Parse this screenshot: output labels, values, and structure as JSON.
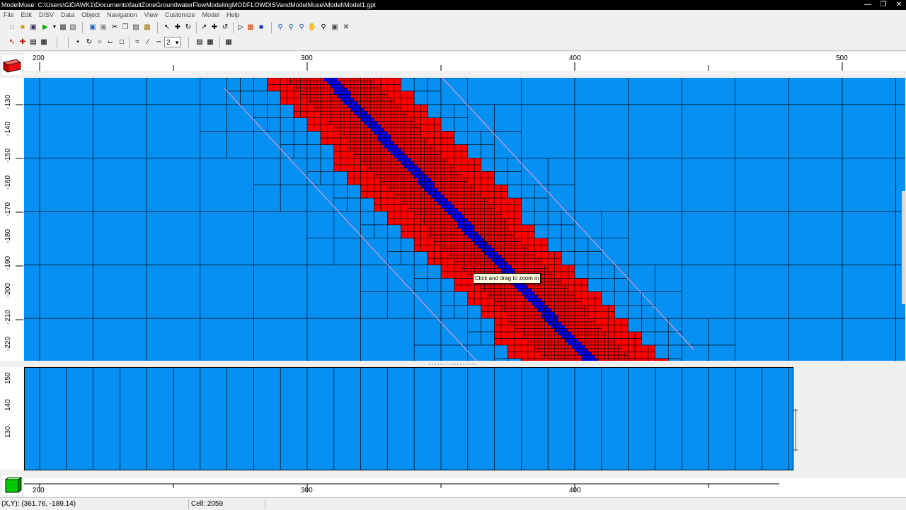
{
  "window": {
    "title": "ModelMuse: C:\\Users\\GIDAWK1\\Documents\\faultZoneGroundwaterFlowModelingMODFLOWDISVandModelMuse\\Model\\Model1.gpt",
    "controls": [
      "minimize-icon",
      "restore-icon",
      "close-icon"
    ]
  },
  "menu": [
    "File",
    "Edit",
    "DISV",
    "Data",
    "Object",
    "Navigation",
    "View",
    "Customize",
    "Model",
    "Help"
  ],
  "toolbar": {
    "row1_icons": [
      "new-icon",
      "open-icon",
      "save-icon",
      "run-icon",
      "run-dropdown-icon",
      "export-icon",
      "print-icon",
      "undo-icon",
      "redo-icon",
      "cut-icon",
      "copy-icon",
      "paste-icon",
      "grid-icon",
      "pointer-icon",
      "edit-vertex-icon",
      "rotate-icon",
      "select-icon",
      "add-point-icon",
      "move-icon",
      "import-icon",
      "color-grid-icon",
      "info-icon",
      "zoom-in-icon",
      "zoom-icon",
      "zoom-out-icon",
      "pan-icon",
      "zoom-extents-icon",
      "restore-view-icon",
      "pin-icon"
    ],
    "row2_icons": [
      "select-object-icon",
      "select-vertex-icon",
      "grid-lines-icon",
      "grid-select-icon",
      "point-icon",
      "polyline-icon",
      "polygon-icon",
      "straight-line-icon",
      "rectangle-icon",
      "lasso-icon",
      "cross-section-icon",
      "reshape-icon"
    ],
    "layer_value": "2",
    "row2_end_icons": [
      "horizontal-grid-icon",
      "grid-mode-icon",
      "spreadsheet-icon"
    ]
  },
  "top_view": {
    "x_ticks": [
      "200",
      "300",
      "400",
      "500"
    ],
    "y_ticks": [
      "-130",
      "-140",
      "-150",
      "-160",
      "-170",
      "-180",
      "-190",
      "-200",
      "-210",
      "-220"
    ],
    "colors": {
      "background": "#0690f2",
      "refined_zone": "#ff0000",
      "fault": "#0000ff",
      "grid_line": "#000000"
    }
  },
  "front_view": {
    "x_ticks": [
      "200",
      "300",
      "400"
    ],
    "z_ticks": [
      "150",
      "140",
      "130"
    ]
  },
  "tooltip": "Click and drag to zoom in",
  "status": {
    "coords": "(X,Y): (361.76, -189.14)",
    "cell": "Cell: 2059"
  }
}
